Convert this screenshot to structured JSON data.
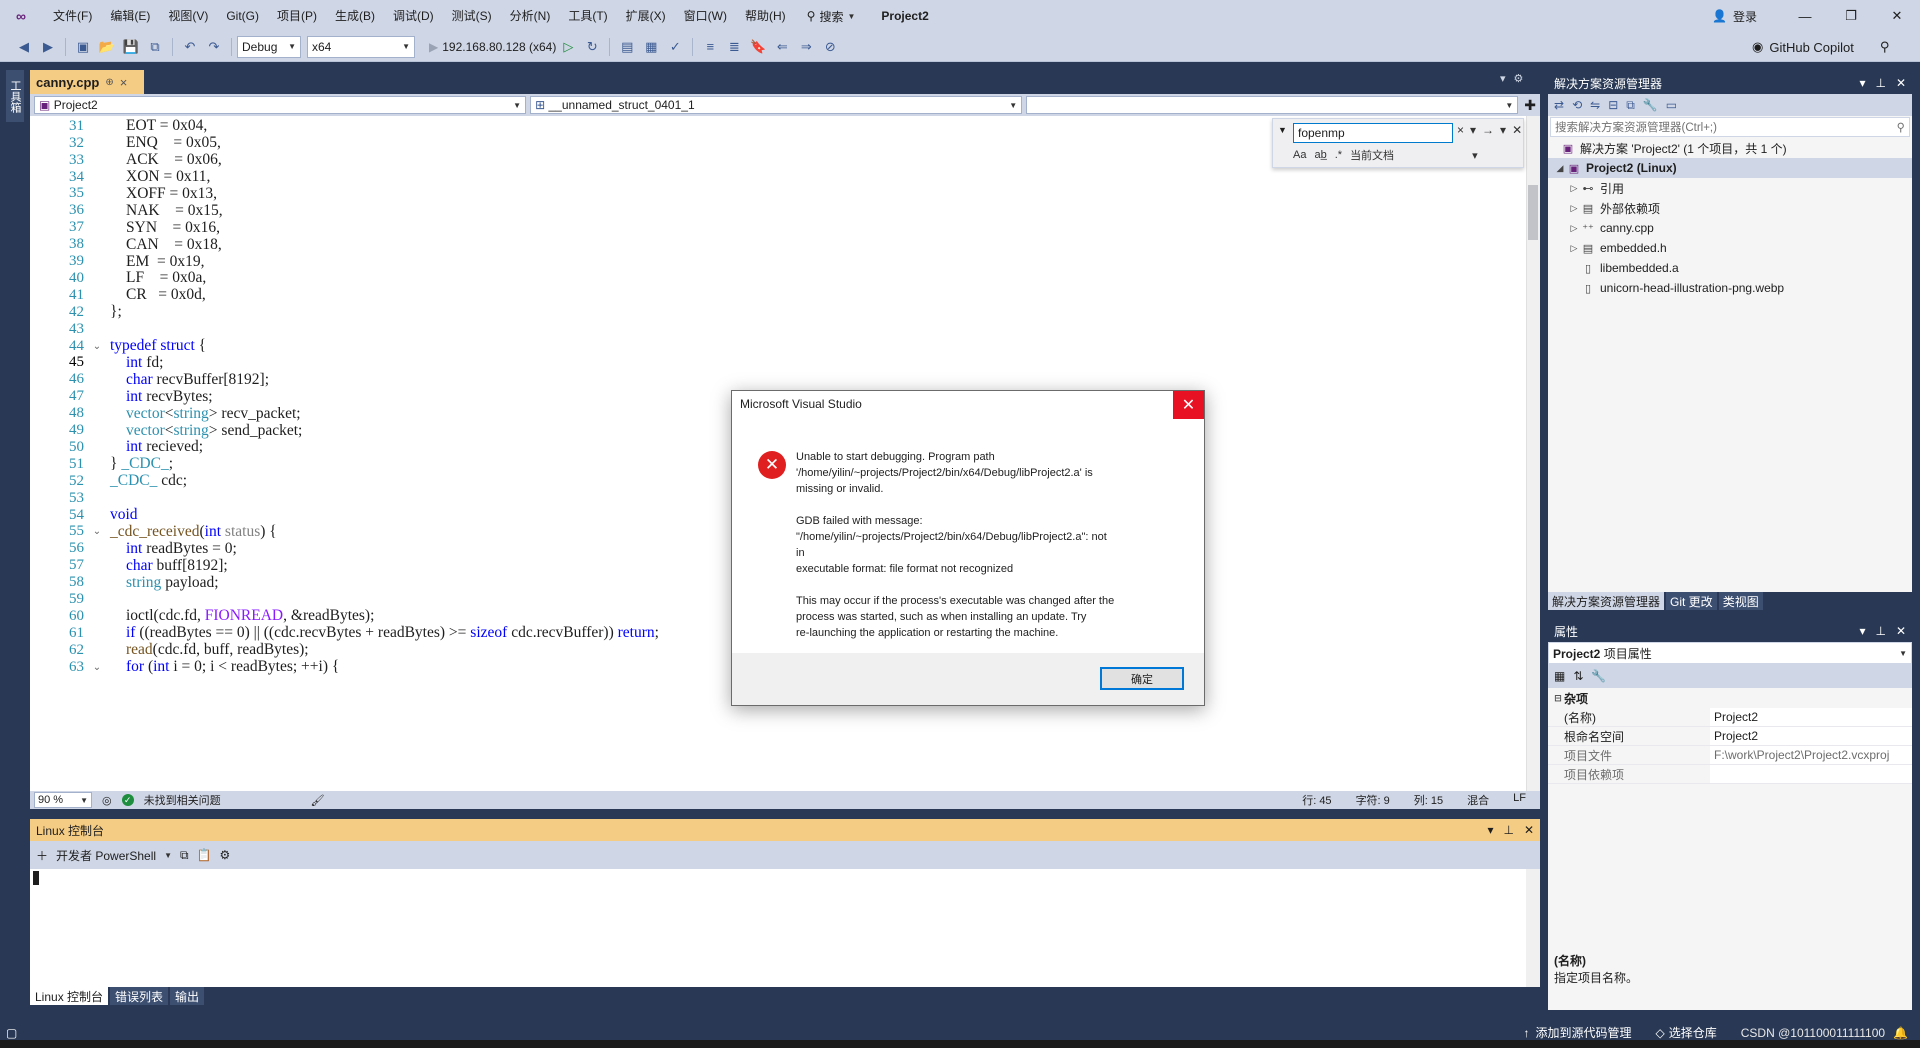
{
  "menubar": {
    "items": [
      "文件(F)",
      "编辑(E)",
      "视图(V)",
      "Git(G)",
      "项目(P)",
      "生成(B)",
      "调试(D)",
      "测试(S)",
      "分析(N)",
      "工具(T)",
      "扩展(X)",
      "窗口(W)",
      "帮助(H)"
    ],
    "search_label": "搜索",
    "project_title": "Project2",
    "login": "登录"
  },
  "toolbar": {
    "config": "Debug",
    "platform": "x64",
    "run_target": "192.168.80.128 (x64)",
    "copilot": "GitHub Copilot"
  },
  "left_strip": {
    "tab": "工具箱"
  },
  "editor": {
    "tab_name": "canny.cpp",
    "nav_project": "Project2",
    "nav_scope": "__unnamed_struct_0401_1",
    "nav_member": "",
    "find": {
      "query": "fopenmp",
      "scope": "当前文档"
    },
    "current_line": 45
  },
  "code_lines": [
    {
      "n": "31",
      "t": "EOT = 0x04,"
    },
    {
      "n": "32",
      "t": "ENQ    = 0x05,"
    },
    {
      "n": "33",
      "t": "ACK    = 0x06,"
    },
    {
      "n": "34",
      "t": "XON = 0x11,"
    },
    {
      "n": "35",
      "t": "XOFF = 0x13,"
    },
    {
      "n": "36",
      "t": "NAK    = 0x15,"
    },
    {
      "n": "37",
      "t": "SYN    = 0x16,"
    },
    {
      "n": "38",
      "t": "CAN    = 0x18,"
    },
    {
      "n": "39",
      "t": "EM  = 0x19,"
    },
    {
      "n": "40",
      "t": "LF    = 0x0a,"
    },
    {
      "n": "41",
      "t": "CR   = 0x0d,"
    },
    {
      "n": "42",
      "t": "};"
    },
    {
      "n": "43",
      "t": ""
    },
    {
      "n": "44",
      "t": "typedef struct {"
    },
    {
      "n": "45",
      "t": "int fd;"
    },
    {
      "n": "46",
      "t": "char recvBuffer[8192];"
    },
    {
      "n": "47",
      "t": "int recvBytes;"
    },
    {
      "n": "48",
      "t": "vector<string> recv_packet;"
    },
    {
      "n": "49",
      "t": "vector<string> send_packet;"
    },
    {
      "n": "50",
      "t": "int recieved;"
    },
    {
      "n": "51",
      "t": "} _CDC_;"
    },
    {
      "n": "52",
      "t": "_CDC_ cdc;"
    },
    {
      "n": "53",
      "t": ""
    },
    {
      "n": "54",
      "t": "void"
    },
    {
      "n": "55",
      "t": "_cdc_received(int status) {"
    },
    {
      "n": "56",
      "t": "int readBytes = 0;"
    },
    {
      "n": "57",
      "t": "char buff[8192];"
    },
    {
      "n": "58",
      "t": "string payload;"
    },
    {
      "n": "59",
      "t": ""
    },
    {
      "n": "60",
      "t": "ioctl(cdc.fd, FIONREAD, &readBytes);"
    },
    {
      "n": "61",
      "t": "if ((readBytes == 0) || ((cdc.recvBytes + readBytes) >= sizeof cdc.recvBuffer)) return;"
    },
    {
      "n": "62",
      "t": "read(cdc.fd, buff, readBytes);"
    },
    {
      "n": "63",
      "t": "for (int i = 0; i < readBytes; ++i) {"
    }
  ],
  "edit_status": {
    "zoom": "90 %",
    "issues": "未找到相关问题",
    "row": "行: 45",
    "char": "字符: 9",
    "col": "列: 15",
    "mixed": "混合",
    "eol": "LF"
  },
  "console": {
    "title": "Linux 控制台",
    "shell": "开发者 PowerShell"
  },
  "bottom_tabs": [
    "Linux 控制台",
    "错误列表",
    "输出"
  ],
  "statusbar": {
    "add_source": "添加到源代码管理",
    "select_repo": "选择仓库",
    "watermark": "CSDN @101100011111100"
  },
  "solution_explorer": {
    "title": "解决方案资源管理器",
    "search_placeholder": "搜索解决方案资源管理器(Ctrl+;)",
    "solution_label": "解决方案 'Project2' (1 个项目，共 1 个)",
    "project_label": "Project2 (Linux)",
    "items": [
      {
        "label": "引用",
        "icon": "reference-icon",
        "expandable": true
      },
      {
        "label": "外部依赖项",
        "icon": "dependencies-icon",
        "expandable": true
      },
      {
        "label": "canny.cpp",
        "icon": "cpp-file-icon",
        "expandable": true
      },
      {
        "label": "embedded.h",
        "icon": "header-file-icon",
        "expandable": true
      },
      {
        "label": "libembedded.a",
        "icon": "file-icon",
        "expandable": false
      },
      {
        "label": "unicorn-head-illustration-png.webp",
        "icon": "file-icon",
        "expandable": false
      }
    ],
    "tabs": [
      "解决方案资源管理器",
      "Git 更改",
      "类视图"
    ]
  },
  "properties": {
    "title": "属性",
    "object": "Project2",
    "object_kind": "项目属性",
    "category": "杂项",
    "rows": [
      {
        "k": "(名称)",
        "v": "Project2"
      },
      {
        "k": "根命名空间",
        "v": "Project2"
      },
      {
        "k": "项目文件",
        "v": "F:\\work\\Project2\\Project2.vcxproj"
      },
      {
        "k": "项目依赖项",
        "v": ""
      }
    ],
    "desc_title": "(名称)",
    "desc_text": "指定项目名称。"
  },
  "dialog": {
    "title": "Microsoft Visual Studio",
    "message": "Unable to start debugging. Program path\n'/home/yilin/~projects/Project2/bin/x64/Debug/libProject2.a' is\nmissing or invalid.\n\nGDB failed with message:\n\"/home/yilin/~projects/Project2/bin/x64/Debug/libProject2.a\": not in\nexecutable format: file format not recognized\n\nThis may occur if the process's executable was changed after the\nprocess was started, such as when installing an update. Try\nre-launching the application or restarting the machine.",
    "ok": "确定"
  }
}
